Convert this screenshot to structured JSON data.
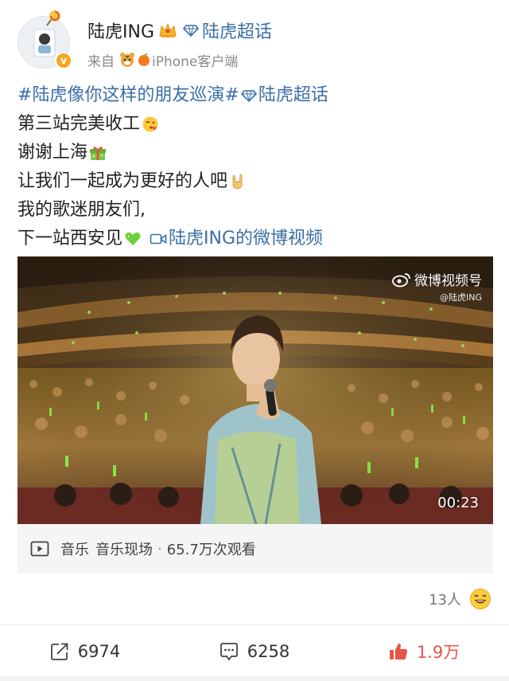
{
  "header": {
    "username": "陆虎ING",
    "supertopic": "陆虎超话",
    "source_prefix": "来自",
    "source_device": "iPhone客户端",
    "verified_badge": "v"
  },
  "post": {
    "lines": [
      {
        "topic1": "#陆虎像你这样的朋友巡演#",
        "topic2": "陆虎超话"
      },
      {
        "text": "第三站完美收工"
      },
      {
        "text": "谢谢上海"
      },
      {
        "text": "让我们一起成为更好的人吧"
      },
      {
        "text": "我的歌迷朋友们,"
      },
      {
        "text": "下一站西安见",
        "video_link": "陆虎ING的微博视频"
      }
    ]
  },
  "video": {
    "watermark_main": "微博视频号",
    "watermark_sub": "@陆虎ING",
    "duration": "00:23",
    "category": "音乐",
    "subcategory": "音乐现场",
    "separator": "·",
    "views": "65.7万次观看"
  },
  "likers": {
    "count_label": "13人"
  },
  "actions": {
    "repost_count": "6974",
    "comment_count": "6258",
    "like_count": "1.9万"
  },
  "colors": {
    "link": "#3b6ea8",
    "like_active": "#e8544a",
    "badge": "#f5a623"
  },
  "icons": [
    "crown-icon",
    "diamond-icon",
    "tiger-icon",
    "orange-icon",
    "kiss-emoji-icon",
    "gift-emoji-icon",
    "rock-hand-emoji-icon",
    "green-heart-icon",
    "video-camera-icon",
    "weibo-icon",
    "play-box-icon",
    "smile-emoji-icon",
    "repost-icon",
    "comment-icon",
    "thumbs-up-icon"
  ]
}
